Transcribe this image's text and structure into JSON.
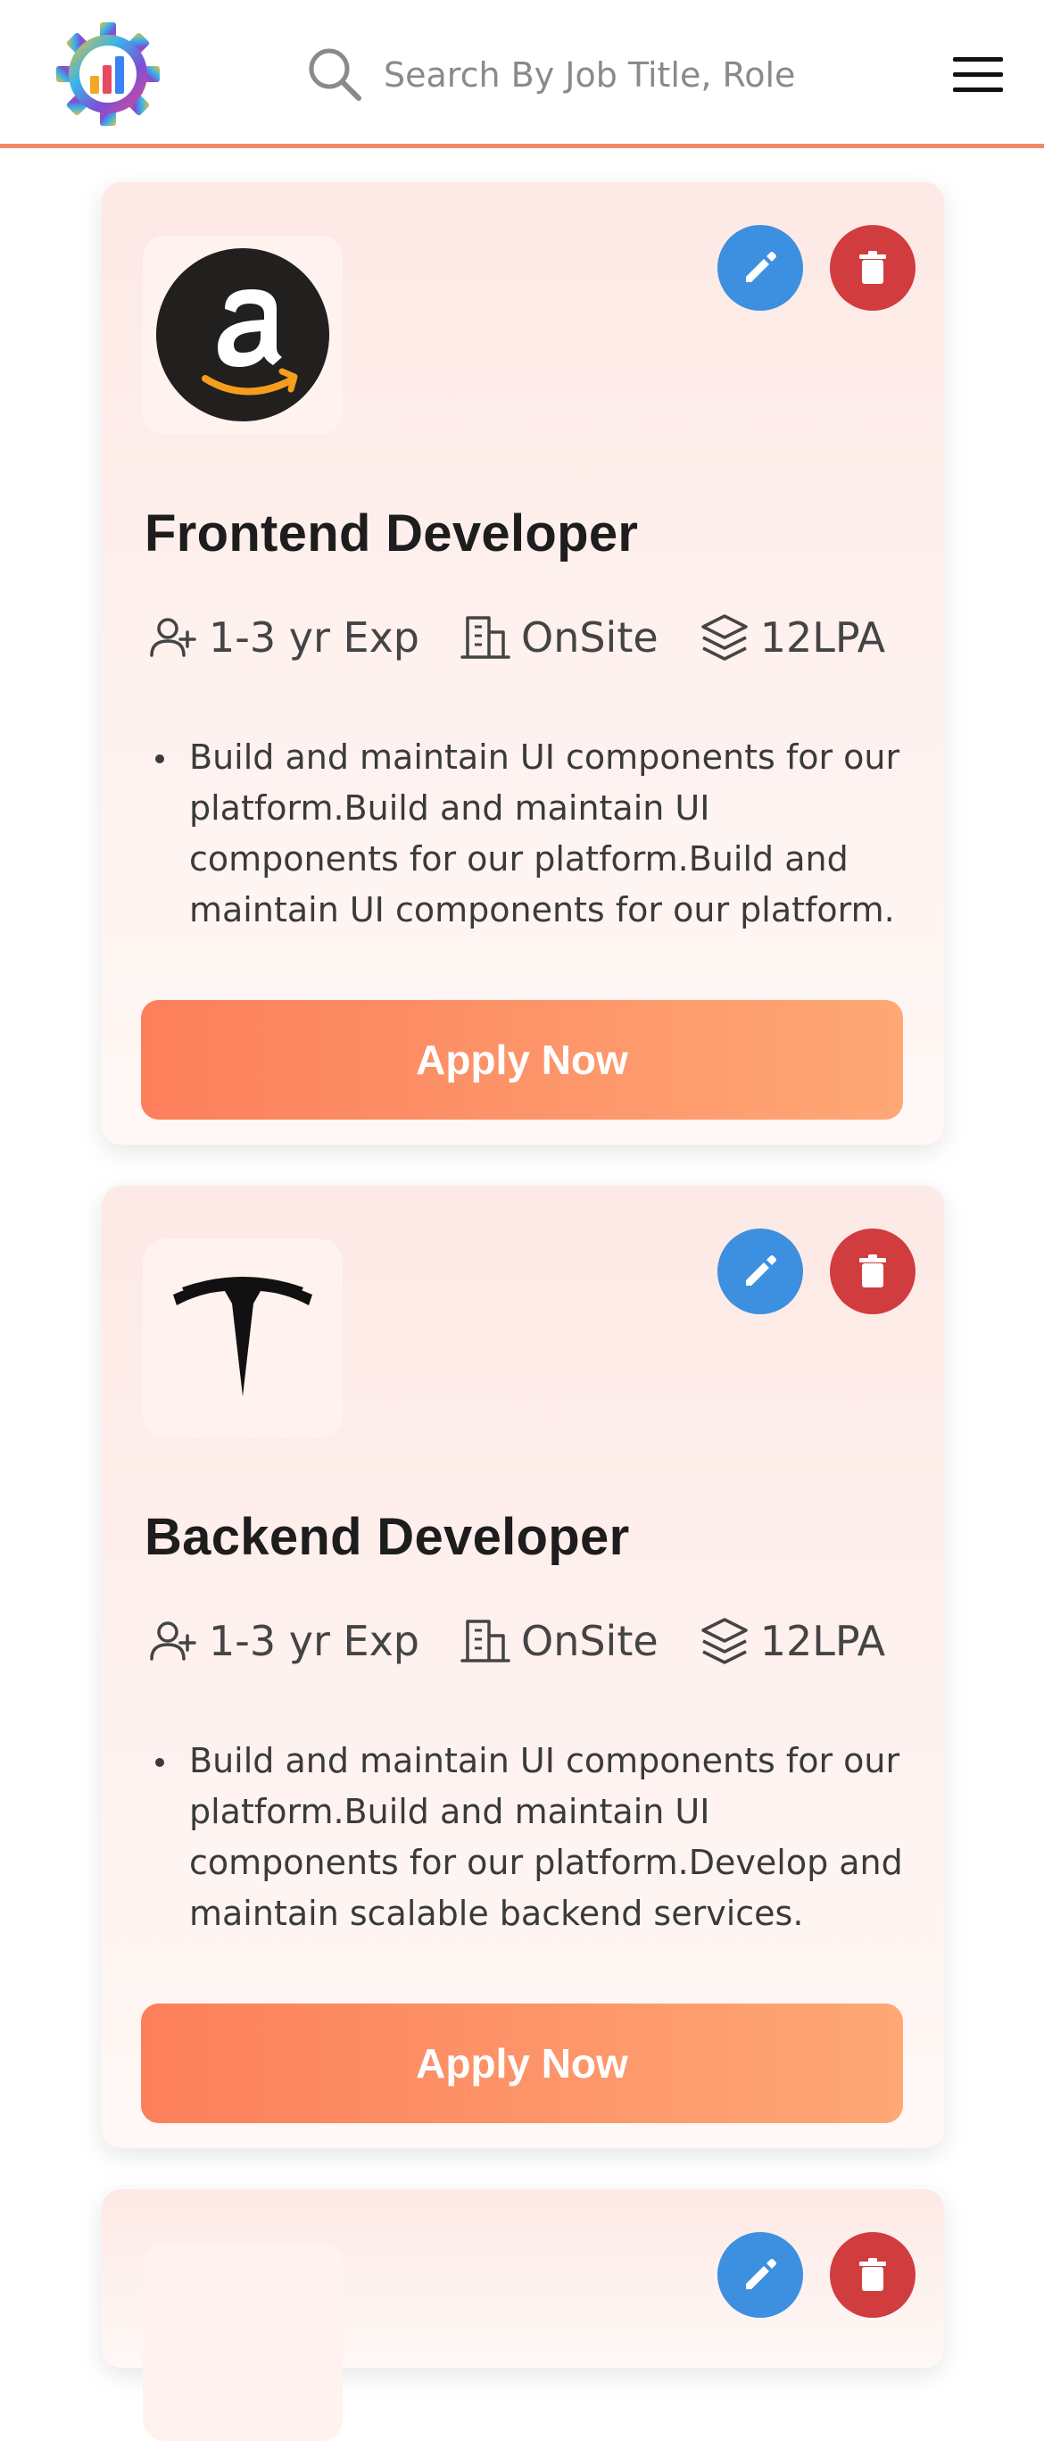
{
  "header": {
    "search_placeholder": "Search By Job Title, Role"
  },
  "jobs": [
    {
      "company_logo": "amazon-logo",
      "title": "Frontend Developer",
      "experience": "1-3 yr Exp",
      "work_mode": "OnSite",
      "salary": "12LPA",
      "description": "Build and maintain UI components for our platform.Build and maintain UI components for our platform.Build and maintain UI components for our platform.",
      "apply_label": "Apply Now"
    },
    {
      "company_logo": "tesla-logo",
      "title": "Backend Developer",
      "experience": "1-3 yr Exp",
      "work_mode": "OnSite",
      "salary": "12LPA",
      "description": "Build and maintain UI components for our platform.Build and maintain UI components for our platform.Develop and maintain scalable backend services.",
      "apply_label": "Apply Now"
    }
  ],
  "icons": {
    "search": "search-icon",
    "menu": "hamburger-menu-icon",
    "edit": "pencil-icon",
    "delete": "trash-icon",
    "experience": "user-plus-icon",
    "work_mode": "building-icon",
    "salary": "layers-icon"
  },
  "colors": {
    "accent": "#f4896a",
    "edit": "#3d8fe0",
    "delete": "#d13c3f",
    "apply_start": "#fc7f5b",
    "apply_end": "#fea876"
  }
}
